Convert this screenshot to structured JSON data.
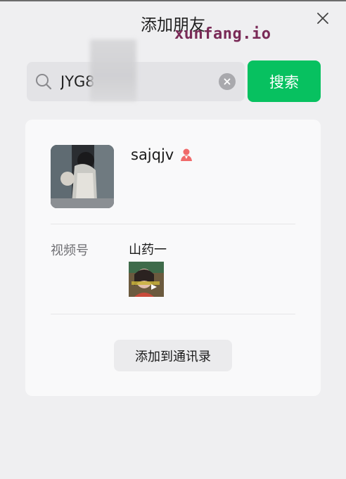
{
  "dialog": {
    "title": "添加朋友",
    "watermark": "xunfang.io"
  },
  "search": {
    "value": "JYG8",
    "placeholder": "",
    "button_label": "搜索"
  },
  "result": {
    "nickname": "sajqjv",
    "gender_icon": "female-user-icon",
    "channels_label": "视频号",
    "channels_name": "山药一",
    "add_button_label": "添加到通讯录"
  },
  "colors": {
    "accent": "#07c160",
    "gender": "#f06a6a"
  }
}
